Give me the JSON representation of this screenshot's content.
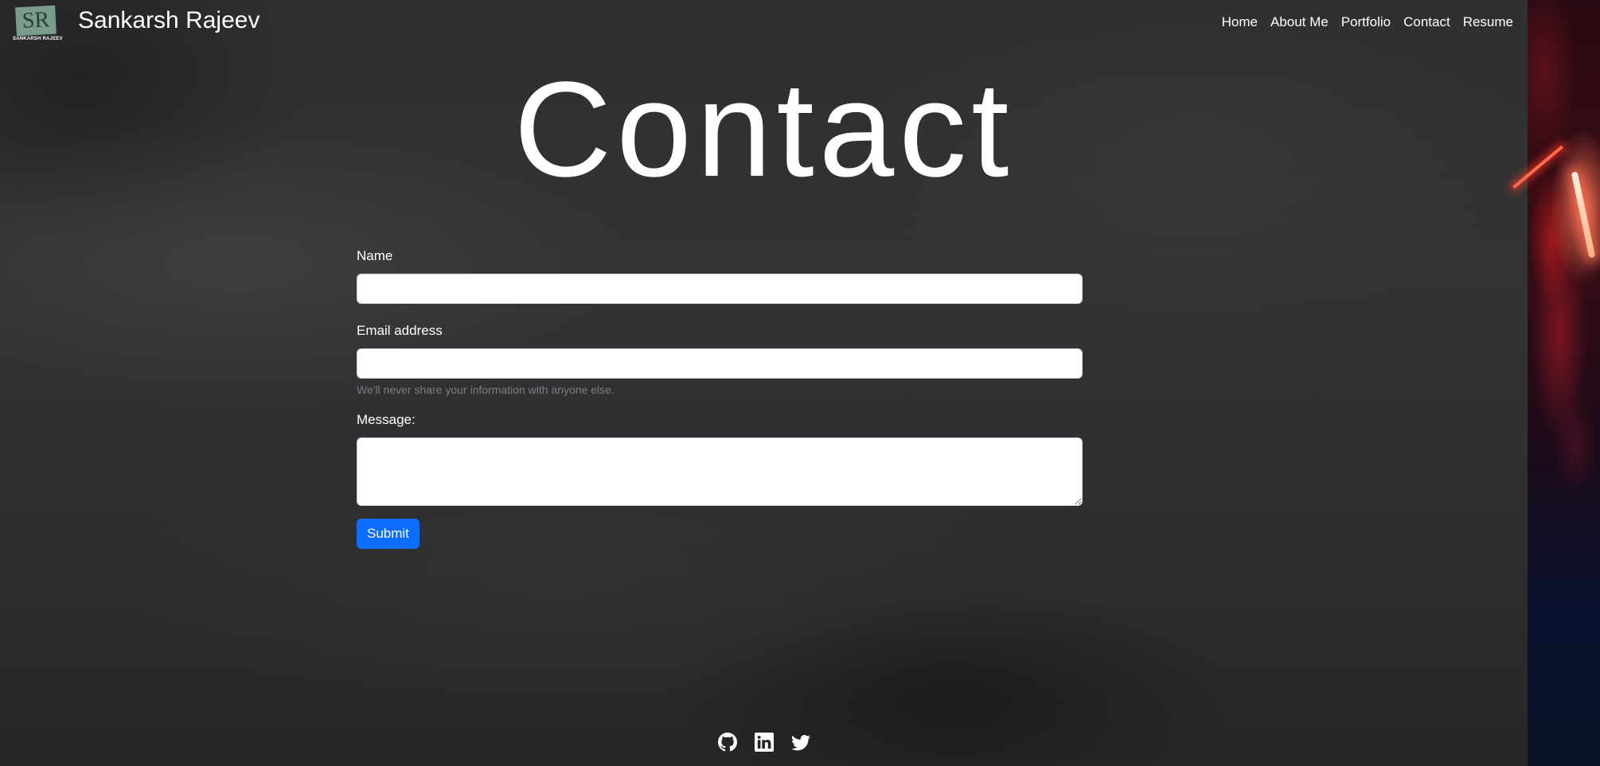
{
  "brand": {
    "logo_text": "SR",
    "logo_caption": "SANKARSH RAJEEV",
    "name": "Sankarsh Rajeev"
  },
  "nav": {
    "items": [
      {
        "label": "Home"
      },
      {
        "label": "About Me"
      },
      {
        "label": "Portfolio"
      },
      {
        "label": "Contact"
      },
      {
        "label": "Resume"
      }
    ]
  },
  "page": {
    "title": "Contact"
  },
  "form": {
    "name_label": "Name",
    "name_value": "",
    "email_label": "Email address",
    "email_value": "",
    "email_help": "We'll never share your information with anyone else.",
    "message_label": "Message:",
    "message_value": "",
    "submit_label": "Submit"
  },
  "footer": {
    "icons": [
      "github-icon",
      "linkedin-icon",
      "twitter-icon"
    ]
  },
  "colors": {
    "accent": "#0d6efd",
    "background": "#2f2f31",
    "logo": "#7a9c8a"
  }
}
